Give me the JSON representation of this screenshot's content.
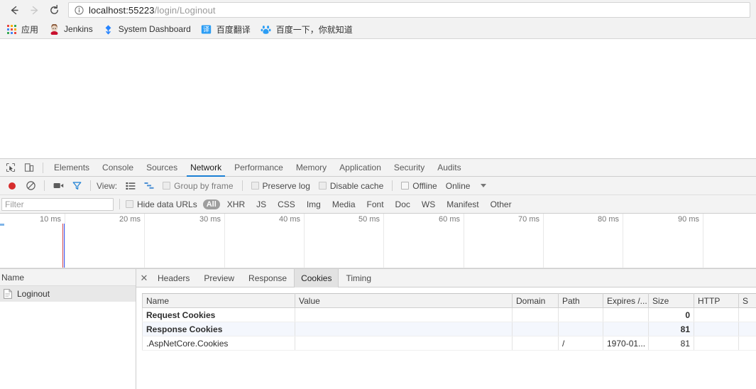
{
  "browser": {
    "nav": {
      "back_icon": "arrow-left-icon",
      "forward_icon": "arrow-right-icon",
      "reload_icon": "reload-icon",
      "info_icon": "page-info-icon"
    },
    "address_bar": {
      "host": "localhost:55223",
      "path": "/login/Loginout",
      "full_url": "localhost:55223/login/Loginout"
    },
    "bookmarks": [
      {
        "label": "应用",
        "icon": "apps-grid-icon"
      },
      {
        "label": "Jenkins",
        "icon": "jenkins-icon"
      },
      {
        "label": "System Dashboard",
        "icon": "jira-icon"
      },
      {
        "label": "百度翻译",
        "icon": "baidu-translate-icon"
      },
      {
        "label": "百度一下，你就知道",
        "icon": "baidu-icon"
      }
    ]
  },
  "devtools": {
    "left_icons": [
      {
        "name": "inspect-element-icon"
      },
      {
        "name": "device-toolbar-icon"
      }
    ],
    "panels": [
      {
        "label": "Elements",
        "active": false
      },
      {
        "label": "Console",
        "active": false
      },
      {
        "label": "Sources",
        "active": false
      },
      {
        "label": "Network",
        "active": true
      },
      {
        "label": "Performance",
        "active": false
      },
      {
        "label": "Memory",
        "active": false
      },
      {
        "label": "Application",
        "active": false
      },
      {
        "label": "Security",
        "active": false
      },
      {
        "label": "Audits",
        "active": false
      }
    ],
    "active_panel": "Network",
    "network_toolbar": {
      "record_icon": "record-button-icon",
      "clear_icon": "clear-icon",
      "screenshot_icon": "camera-icon",
      "filter_icon": "filter-funnel-icon",
      "view_label": "View:",
      "view_list_icon": "list-view-icon",
      "view_waterfall_icon": "waterfall-view-icon",
      "group_by_frame": "Group by frame",
      "preserve_log": "Preserve log",
      "disable_cache": "Disable cache",
      "offline": "Offline",
      "online": "Online",
      "throttle_caret_icon": "chevron-down-icon"
    },
    "filter_bar": {
      "filter_placeholder": "Filter",
      "filter_value": "",
      "hide_data_urls": "Hide data URLs",
      "types": [
        {
          "label": "All",
          "active": true
        },
        {
          "label": "XHR",
          "active": false
        },
        {
          "label": "JS",
          "active": false
        },
        {
          "label": "CSS",
          "active": false
        },
        {
          "label": "Img",
          "active": false
        },
        {
          "label": "Media",
          "active": false
        },
        {
          "label": "Font",
          "active": false
        },
        {
          "label": "Doc",
          "active": false
        },
        {
          "label": "WS",
          "active": false
        },
        {
          "label": "Manifest",
          "active": false
        },
        {
          "label": "Other",
          "active": false
        }
      ]
    },
    "timeline": {
      "ticks": [
        "10 ms",
        "20 ms",
        "30 ms",
        "40 ms",
        "50 ms",
        "60 ms",
        "70 ms",
        "80 ms",
        "90 ms"
      ],
      "unit": "ms",
      "interval": 10,
      "markers": [
        {
          "name": "dom-content-loaded-marker",
          "color": "#3d5afe"
        },
        {
          "name": "load-event-marker",
          "color": "#d64a4a"
        }
      ]
    },
    "requests_panel": {
      "column_header": "Name",
      "rows": [
        {
          "name": "Loginout",
          "icon": "document-icon",
          "selected": true
        }
      ]
    },
    "detail_panel": {
      "close_icon": "close-icon",
      "tabs": [
        {
          "label": "Headers",
          "active": false
        },
        {
          "label": "Preview",
          "active": false
        },
        {
          "label": "Response",
          "active": false
        },
        {
          "label": "Cookies",
          "active": true
        },
        {
          "label": "Timing",
          "active": false
        }
      ],
      "active_tab": "Cookies",
      "cookies_table": {
        "columns": [
          "Name",
          "Value",
          "Domain",
          "Path",
          "Expires /...",
          "Size",
          "HTTP",
          "S"
        ],
        "rows": [
          {
            "name": "Request Cookies",
            "value": "",
            "domain": "",
            "path": "",
            "expires": "",
            "size": "0",
            "http": "",
            "secure": "",
            "group": true
          },
          {
            "name": "Response Cookies",
            "value": "",
            "domain": "",
            "path": "",
            "expires": "",
            "size": "81",
            "http": "",
            "secure": "",
            "group": true
          },
          {
            "name": ".AspNetCore.Cookies",
            "value": "",
            "domain": "",
            "path": "/",
            "expires": "1970-01...",
            "size": "81",
            "http": "",
            "secure": "",
            "group": false
          }
        ]
      }
    }
  },
  "colors": {
    "accent": "#1a7fd4",
    "record": "#d62c2c",
    "chrome_bg": "#f2f2f2",
    "selected_row": "#e8e8e8",
    "alt_row": "#f4f7fd"
  }
}
